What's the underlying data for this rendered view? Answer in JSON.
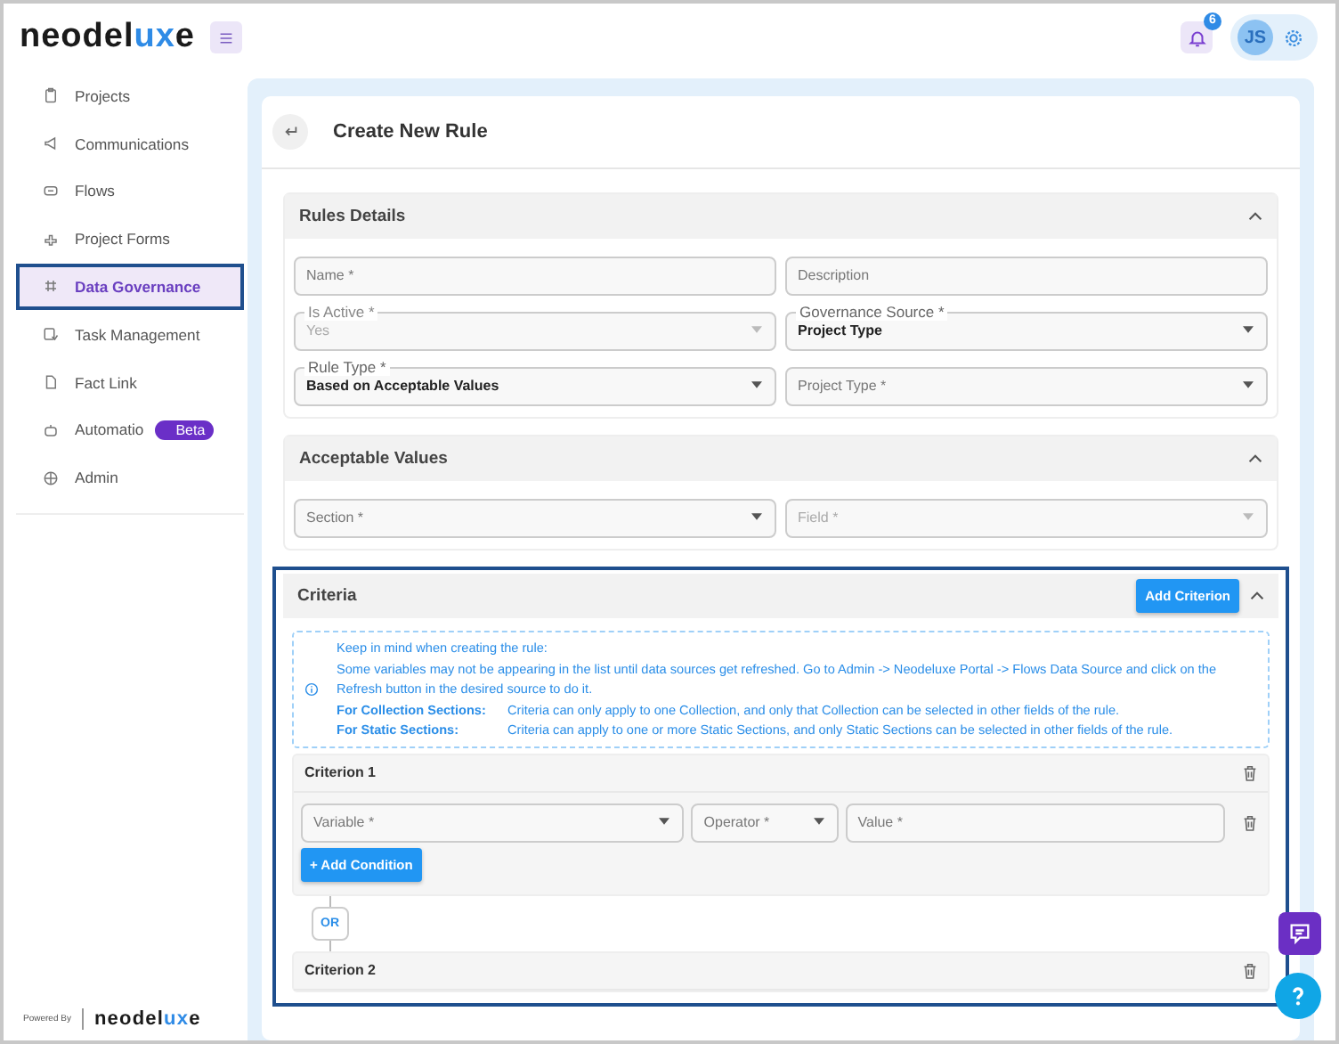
{
  "header": {
    "logo": [
      {
        "text": "neodel",
        "accent": false
      },
      {
        "text": "ux",
        "accent": true
      },
      {
        "text": "e",
        "accent": false
      }
    ],
    "notification_count": "6",
    "avatar_initials": "JS"
  },
  "sidebar": {
    "items": [
      {
        "label": "Projects",
        "selected": false
      },
      {
        "label": "Communications",
        "selected": false
      },
      {
        "label": "Flows",
        "selected": false
      },
      {
        "label": "Project Forms",
        "selected": false
      },
      {
        "label": "Data Governance",
        "selected": true
      },
      {
        "label": "Task Management",
        "selected": false
      },
      {
        "label": "Fact Link",
        "selected": false
      },
      {
        "label": "Automatio",
        "selected": false,
        "badge": "Beta"
      },
      {
        "label": "Admin",
        "selected": false
      }
    ],
    "footer": {
      "powered_by": "Powered By",
      "logo": [
        {
          "text": "neodel",
          "accent": false
        },
        {
          "text": "ux",
          "accent": true
        },
        {
          "text": "e",
          "accent": false
        }
      ]
    }
  },
  "page": {
    "title": "Create New Rule",
    "sections": [
      {
        "kind": "fields",
        "title": "Rules Details",
        "expanded": true,
        "highlighted": false,
        "rows": [
          [
            {
              "kind": "text",
              "label": "Name *",
              "disabled": false
            },
            {
              "kind": "text",
              "label": "Description",
              "disabled": false
            }
          ],
          [
            {
              "kind": "select",
              "label": "Is Active *",
              "value": "Yes",
              "disabled": true
            },
            {
              "kind": "select",
              "label": "Governance Source *",
              "value": "Project Type",
              "disabled": false
            }
          ],
          [
            {
              "kind": "select",
              "label": "Rule Type *",
              "value": "Based on Acceptable Values",
              "disabled": false
            },
            {
              "kind": "select",
              "label": "Project Type *",
              "disabled": false
            }
          ]
        ]
      },
      {
        "kind": "fields",
        "title": "Acceptable Values",
        "expanded": true,
        "highlighted": false,
        "rows": [
          [
            {
              "kind": "select",
              "label": "Section *",
              "disabled": false
            },
            {
              "kind": "select",
              "label": "Field *",
              "disabled": true
            }
          ]
        ]
      },
      {
        "kind": "criteria",
        "title": "Criteria",
        "expanded": true,
        "highlighted": true,
        "button": "Add Criterion",
        "info": {
          "heading": "Keep in mind when creating the rule:",
          "text": "Some variables may not be appearing in the list until data sources get refreshed. Go to Admin -> Neodeluxe Portal -> Flows Data Source and click on the Refresh button in the desired source to do it.",
          "notes": [
            {
              "term": "For Collection Sections:",
              "text": "Criteria can only apply to one Collection, and only that Collection can be selected in other fields of the rule."
            },
            {
              "term": "For Static Sections:",
              "text": "Criteria can apply to one or more Static Sections, and only Static Sections can be selected in other fields of the rule."
            }
          ]
        },
        "criteria": [
          {
            "title": "Criterion 1",
            "conditions": [
              {
                "variable": "Variable *",
                "operator": "Operator *",
                "value_placeholder": "Value *"
              }
            ],
            "add_button": "+ Add Condition"
          },
          {
            "title": "Criterion 2"
          }
        ],
        "joiner": "OR"
      }
    ]
  }
}
